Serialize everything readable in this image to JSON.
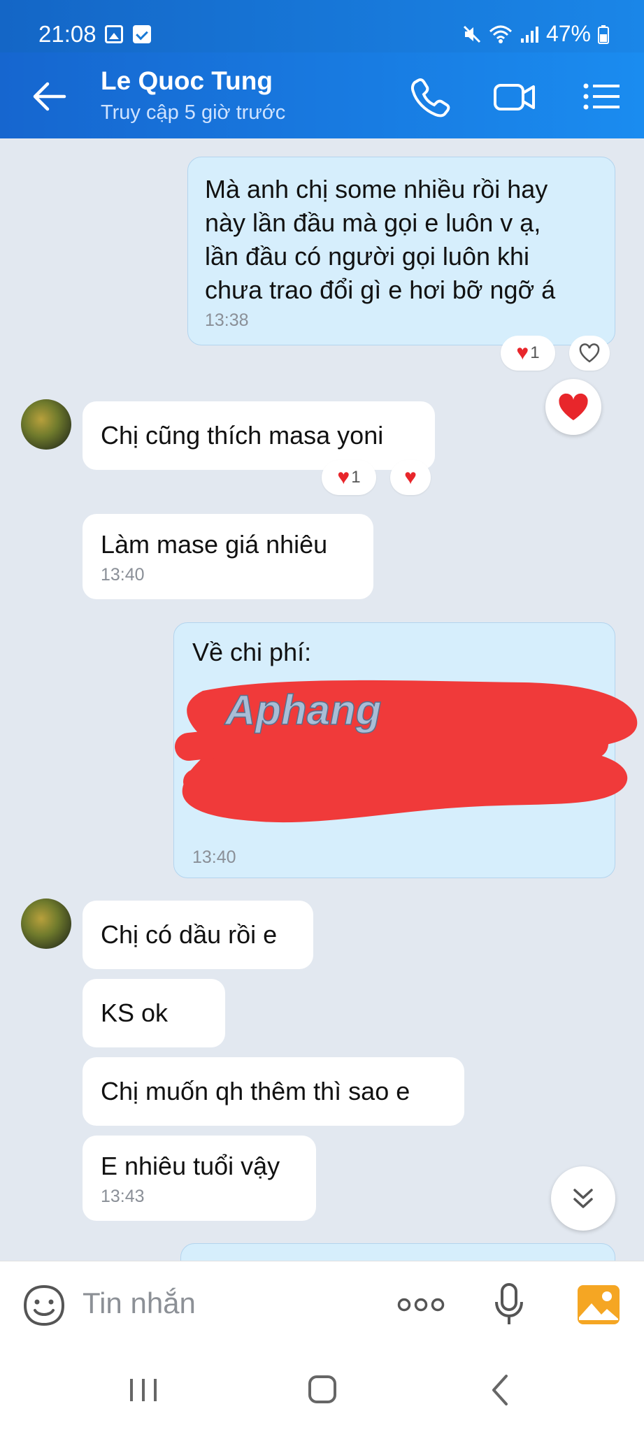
{
  "status_bar": {
    "time": "21:08",
    "battery": "47%",
    "icons": [
      "gallery-icon",
      "check-icon",
      "mute-icon",
      "wifi-icon",
      "signal-icon",
      "battery-icon"
    ]
  },
  "header": {
    "title": "Le Quoc Tung",
    "subtitle": "Truy cập 5 giờ trước",
    "buttons": [
      "back-arrow-icon",
      "phone-icon",
      "video-call-icon",
      "menu-icon"
    ],
    "accent": "#1a7ee6"
  },
  "messages": [
    {
      "dir": "out",
      "lines": [
        "Mà anh chị some nhiều rồi hay",
        "này lần đầu mà gọi e luôn v ạ,",
        "lần đầu có người gọi luôn khi",
        "chưa trao đổi gì e hơi bỡ ngỡ á"
      ],
      "time": "13:38",
      "reaction_count": "1"
    },
    {
      "dir": "in",
      "text": "Chị cũng thích masa yoni",
      "reaction_count": "1"
    },
    {
      "dir": "in",
      "text": "Làm mase giá nhiêu",
      "time": "13:40"
    },
    {
      "dir": "out",
      "text": "Về chi phí:",
      "time": "13:40",
      "watermark": "Aphang"
    },
    {
      "dir": "in",
      "text": "Chị có dầu rồi e"
    },
    {
      "dir": "in",
      "text": "KS ok"
    },
    {
      "dir": "in",
      "text": "Chị muốn qh thêm thì sao e"
    },
    {
      "dir": "in",
      "text": "E nhiêu tuổi vậy",
      "time": "13:43"
    }
  ],
  "input": {
    "placeholder": "Tin nhắn",
    "icons": [
      "emoji-icon",
      "more-icon",
      "microphone-icon",
      "image-icon"
    ]
  },
  "colors": {
    "out_bubble": "#d6eefc",
    "in_bubble": "#ffffff",
    "background": "#e2e8f0",
    "heart": "#e8262b",
    "redaction": "#f03a3a"
  }
}
